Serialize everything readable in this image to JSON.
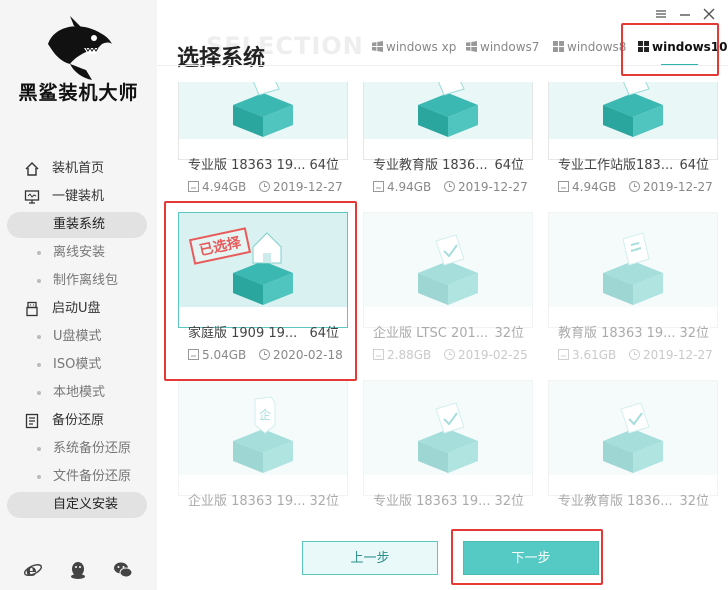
{
  "brand": {
    "name": "黑鲨装机大师"
  },
  "page": {
    "title": "选择系统",
    "ghost_text": "SELECTION"
  },
  "tabs": [
    {
      "label": "windows xp",
      "active": false
    },
    {
      "label": "windows7",
      "active": false
    },
    {
      "label": "windows8",
      "active": false
    },
    {
      "label": "windows10",
      "active": true
    }
  ],
  "sidebar": {
    "items": [
      {
        "label": "装机首页",
        "type": "section",
        "icon": "home-icon"
      },
      {
        "label": "一键装机",
        "type": "section",
        "icon": "monitor-icon"
      },
      {
        "label": "重装系统",
        "type": "sub",
        "active": true
      },
      {
        "label": "离线安装",
        "type": "sub"
      },
      {
        "label": "制作离线包",
        "type": "sub"
      },
      {
        "label": "启动U盘",
        "type": "section",
        "icon": "usb-icon"
      },
      {
        "label": "U盘模式",
        "type": "sub"
      },
      {
        "label": "ISO模式",
        "type": "sub"
      },
      {
        "label": "本地模式",
        "type": "sub"
      },
      {
        "label": "备份还原",
        "type": "section",
        "icon": "backup-icon"
      },
      {
        "label": "系统备份还原",
        "type": "sub"
      },
      {
        "label": "文件备份还原",
        "type": "sub"
      },
      {
        "label": "自定义安装",
        "type": "sub",
        "active": true
      }
    ],
    "footer_icons": [
      "ie-browser-icon",
      "qq-icon",
      "wechat-icon"
    ]
  },
  "cards": [
    {
      "name": "专业版 18363 19...",
      "bits": "64位",
      "size": "4.94GB",
      "date": "2019-12-27",
      "state": "normal"
    },
    {
      "name": "专业教育版 1836...",
      "bits": "64位",
      "size": "4.94GB",
      "date": "2019-12-27",
      "state": "normal"
    },
    {
      "name": "专业工作站版183...",
      "bits": "64位",
      "size": "4.94GB",
      "date": "2019-12-27",
      "state": "normal"
    },
    {
      "name": "家庭版 1909 19...",
      "bits": "64位",
      "size": "5.04GB",
      "date": "2020-02-18",
      "state": "selected",
      "stamp": "已选择"
    },
    {
      "name": "企业版 LTSC 201...",
      "bits": "32位",
      "size": "2.88GB",
      "date": "2019-02-25",
      "state": "faded"
    },
    {
      "name": "教育版 18363 19...",
      "bits": "32位",
      "size": "3.61GB",
      "date": "2019-12-27",
      "state": "faded"
    },
    {
      "name": "企业版 18363 19...",
      "bits": "32位",
      "state": "faded"
    },
    {
      "name": "专业版 18363 19...",
      "bits": "32位",
      "state": "faded"
    },
    {
      "name": "专业教育版 1836...",
      "bits": "32位",
      "state": "faded"
    }
  ],
  "buttons": {
    "prev": "上一步",
    "next": "下一步"
  },
  "colors": {
    "accent": "#55c9c3",
    "highlight": "#e53935",
    "sidebar_bg": "#f5f5f5"
  }
}
